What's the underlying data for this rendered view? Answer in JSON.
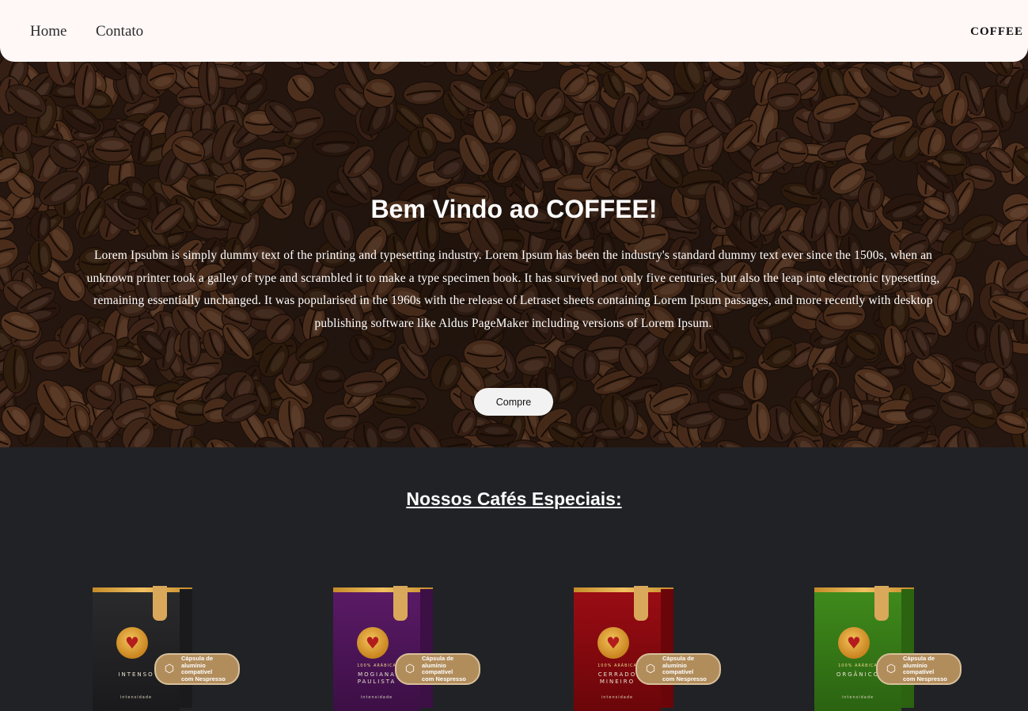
{
  "nav": {
    "links": [
      "Home",
      "Contato"
    ],
    "brand": "COFFEE"
  },
  "hero": {
    "title": "Bem Vindo ao COFFEE!",
    "text": "Lorem Ipsubm is simply dummy text of the printing and typesetting industry. Lorem Ipsum has been the industry's standard dummy text ever since the 1500s, when an unknown printer took a galley of type and scrambled it to make a type specimen book. It has survived not only five centuries, but also the leap into electronic typesetting, remaining essentially unchanged. It was popularised in the 1960s with the release of Letraset sheets containing Lorem Ipsum passages, and more recently with desktop publishing software like Aldus PageMaker including versions of Lorem Ipsum.",
    "button": "Compre"
  },
  "section": {
    "title": "Nossos Cafés Especiais:"
  },
  "products": [
    {
      "flavor": "INTENSO",
      "subtitle": "",
      "intensity": "intensidade",
      "badge": "Cápsula de\nalumínio compatível\ncom Nespresso",
      "color": "#2a2a2c",
      "side": "#1a1a1c"
    },
    {
      "flavor": "MOGIANA\nPAULISTA",
      "subtitle": "100% ARÁBICA",
      "intensity": "intensidade",
      "badge": "Cápsula de\nalumínio compatível\ncom Nespresso",
      "color": "#5a1a66",
      "side": "#3c0f45"
    },
    {
      "flavor": "CERRADO\nMINEIRO",
      "subtitle": "100% ARÁBICA",
      "intensity": "intensidade",
      "badge": "Cápsula de\nalumínio compatível\ncom Nespresso",
      "color": "#9a0c14",
      "side": "#6a0609"
    },
    {
      "flavor": "ORGÂNICO",
      "subtitle": "100% ARÁBICA",
      "intensity": "intensidade",
      "badge": "Cápsula de\nalumínio compatível\ncom Nespresso",
      "color": "#3f8a1c",
      "side": "#2b6311"
    }
  ],
  "icons": {
    "logo": "heart-logo-icon",
    "capsule": "capsule-icon"
  }
}
